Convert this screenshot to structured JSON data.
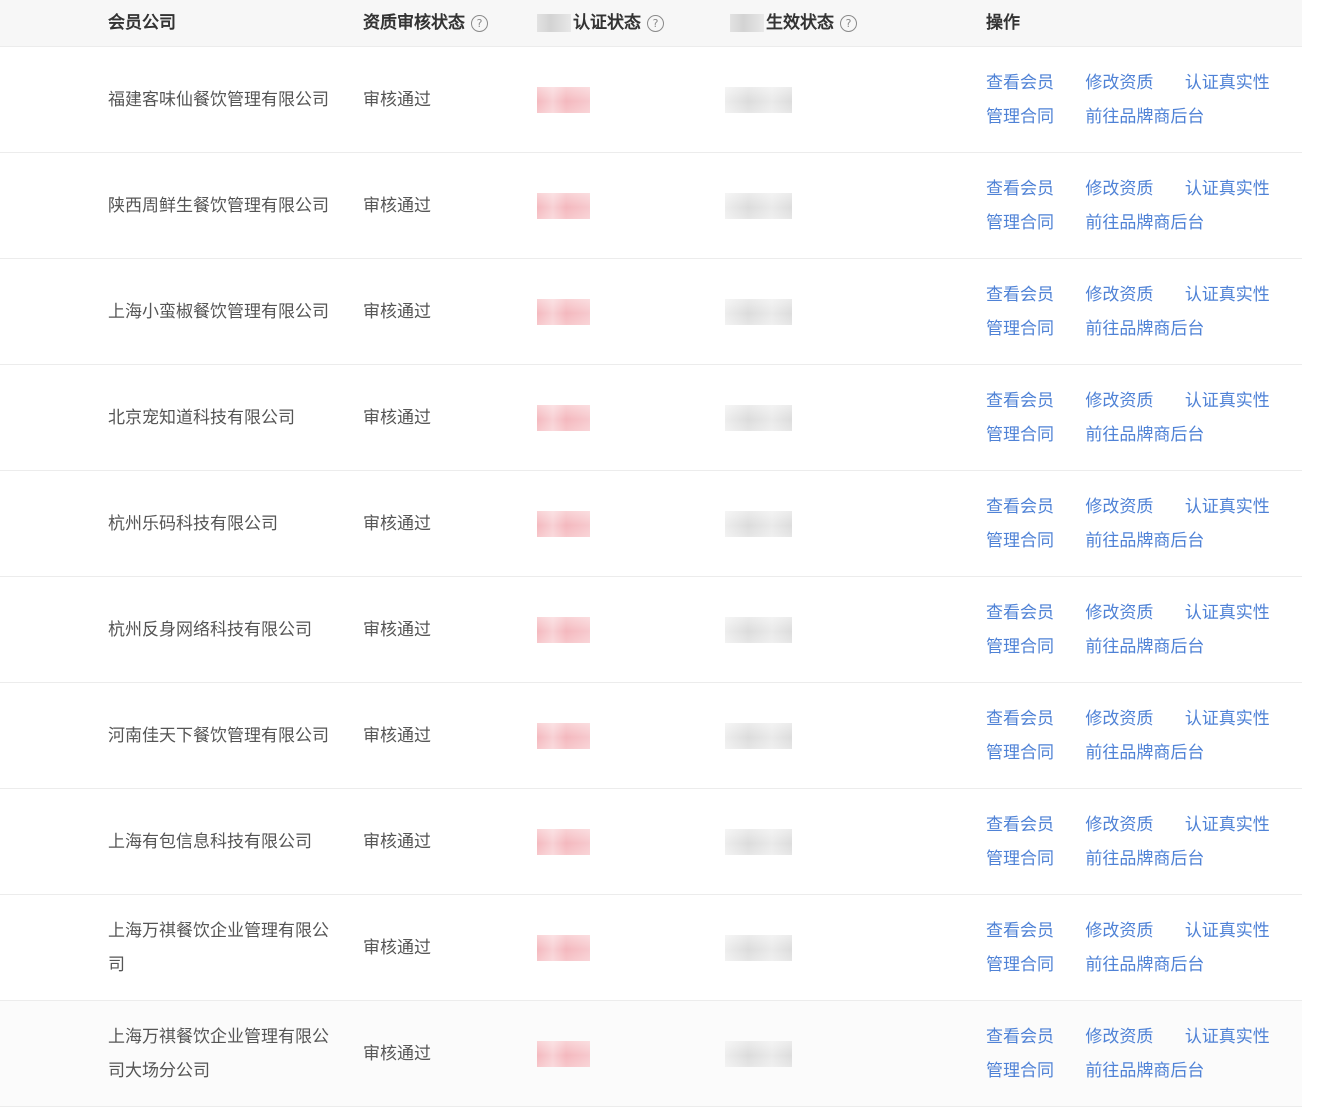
{
  "table": {
    "headers": {
      "company": "会员公司",
      "qual_status": "资质审核状态",
      "auth_status": "认证状态",
      "contract_status": "生效状态",
      "actions": "操作"
    },
    "rows": [
      {
        "company": "福建客味仙餐饮管理有限公司",
        "status": "审核通过"
      },
      {
        "company": "陕西周鲜生餐饮管理有限公司",
        "status": "审核通过"
      },
      {
        "company": "上海小蛮椒餐饮管理有限公司",
        "status": "审核通过"
      },
      {
        "company": "北京宠知道科技有限公司",
        "status": "审核通过"
      },
      {
        "company": "杭州乐码科技有限公司",
        "status": "审核通过"
      },
      {
        "company": "杭州反身网络科技有限公司",
        "status": "审核通过"
      },
      {
        "company": "河南佳天下餐饮管理有限公司",
        "status": "审核通过"
      },
      {
        "company": "上海有包信息科技有限公司",
        "status": "审核通过"
      },
      {
        "company": "上海万祺餐饮企业管理有限公司",
        "status": "审核通过"
      },
      {
        "company": "上海万祺餐饮企业管理有限公司大场分公司",
        "status": "审核通过"
      }
    ],
    "actions": {
      "view_member": "查看会员",
      "edit_qualification": "修改资质",
      "verify_authenticity": "认证真实性",
      "manage_contract": "管理合同",
      "goto_brand_backend": "前往品牌商后台"
    }
  },
  "colors": {
    "link": "#4f82d6",
    "header_bg": "#f7f7f7",
    "text": "#555555"
  }
}
